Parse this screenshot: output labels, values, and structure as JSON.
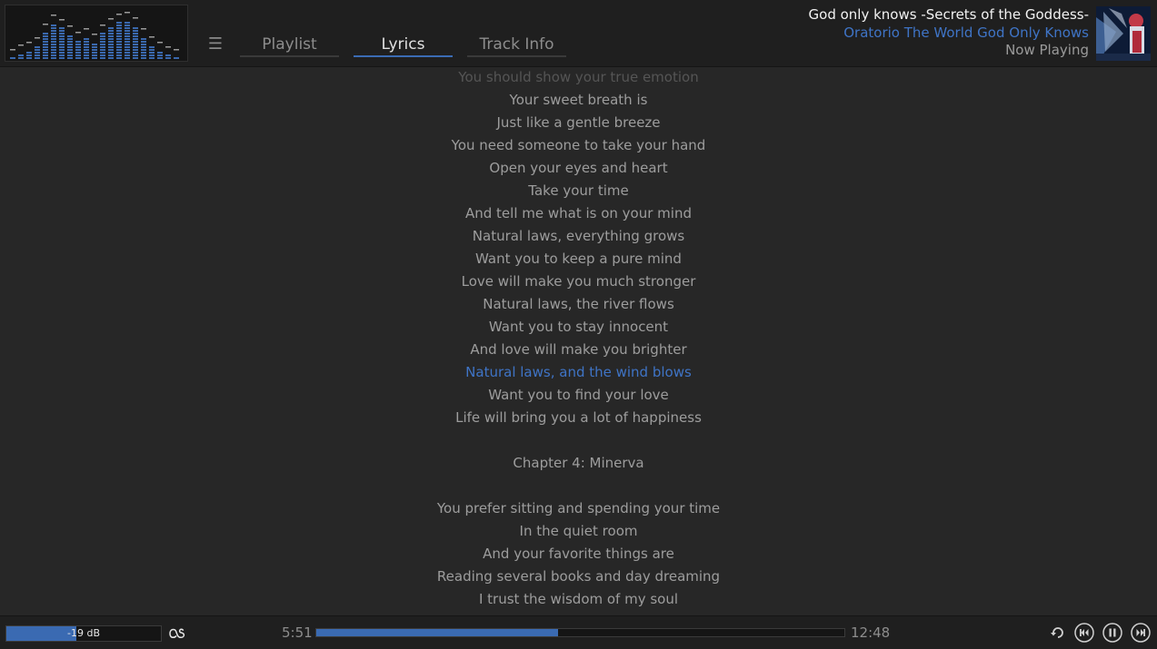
{
  "header": {
    "menu_icon": "hamburger-icon",
    "tabs": [
      {
        "label": "Playlist",
        "active": false
      },
      {
        "label": "Lyrics",
        "active": true
      },
      {
        "label": "Track Info",
        "active": false
      }
    ],
    "now_playing": {
      "title": "God only knows -Secrets of the Goddess-",
      "album": "Oratorio The World God Only Knows",
      "status": "Now Playing"
    }
  },
  "visualizer": {
    "levels": [
      0.05,
      0.15,
      0.22,
      0.3,
      0.6,
      0.78,
      0.7,
      0.55,
      0.42,
      0.5,
      0.38,
      0.58,
      0.72,
      0.8,
      0.85,
      0.74,
      0.5,
      0.32,
      0.22,
      0.12,
      0.06
    ]
  },
  "lyrics": {
    "lines": [
      {
        "text": "You should show your true emotion",
        "state": "faded"
      },
      {
        "text": "Your sweet breath is",
        "state": "normal"
      },
      {
        "text": "Just like a gentle breeze",
        "state": "normal"
      },
      {
        "text": "You need someone to take your hand",
        "state": "normal"
      },
      {
        "text": "Open your eyes and heart",
        "state": "normal"
      },
      {
        "text": "Take your time",
        "state": "normal"
      },
      {
        "text": "And tell me what is on your mind",
        "state": "normal"
      },
      {
        "text": "Natural laws, everything grows",
        "state": "normal"
      },
      {
        "text": "Want you to keep a pure mind",
        "state": "normal"
      },
      {
        "text": "Love will make you much stronger",
        "state": "normal"
      },
      {
        "text": "Natural laws, the river flows",
        "state": "normal"
      },
      {
        "text": "Want you to stay innocent",
        "state": "normal"
      },
      {
        "text": "And love will make you brighter",
        "state": "normal"
      },
      {
        "text": "Natural laws, and the wind blows",
        "state": "current"
      },
      {
        "text": "Want you to find your love",
        "state": "normal"
      },
      {
        "text": "Life will bring you a lot of happiness",
        "state": "normal"
      },
      {
        "text": "",
        "state": "normal"
      },
      {
        "text": "Chapter 4: Minerva",
        "state": "normal"
      },
      {
        "text": "",
        "state": "normal"
      },
      {
        "text": "You prefer sitting and spending your time",
        "state": "normal"
      },
      {
        "text": "In the quiet room",
        "state": "normal"
      },
      {
        "text": "And your favorite things are",
        "state": "normal"
      },
      {
        "text": "Reading several books and day dreaming",
        "state": "normal"
      },
      {
        "text": "I trust the wisdom of my soul",
        "state": "normal"
      }
    ]
  },
  "footer": {
    "volume_label": "-19 dB",
    "volume_level": 0.45,
    "lastfm_icon": "lastfm-icon",
    "elapsed": "5:51",
    "total": "12:48",
    "progress": 0.457,
    "controls": [
      "repeat-icon",
      "previous-icon",
      "pause-icon",
      "next-icon"
    ]
  },
  "colors": {
    "accent": "#3f74c6",
    "background": "#272727",
    "header_bg": "#1f1f1f"
  }
}
